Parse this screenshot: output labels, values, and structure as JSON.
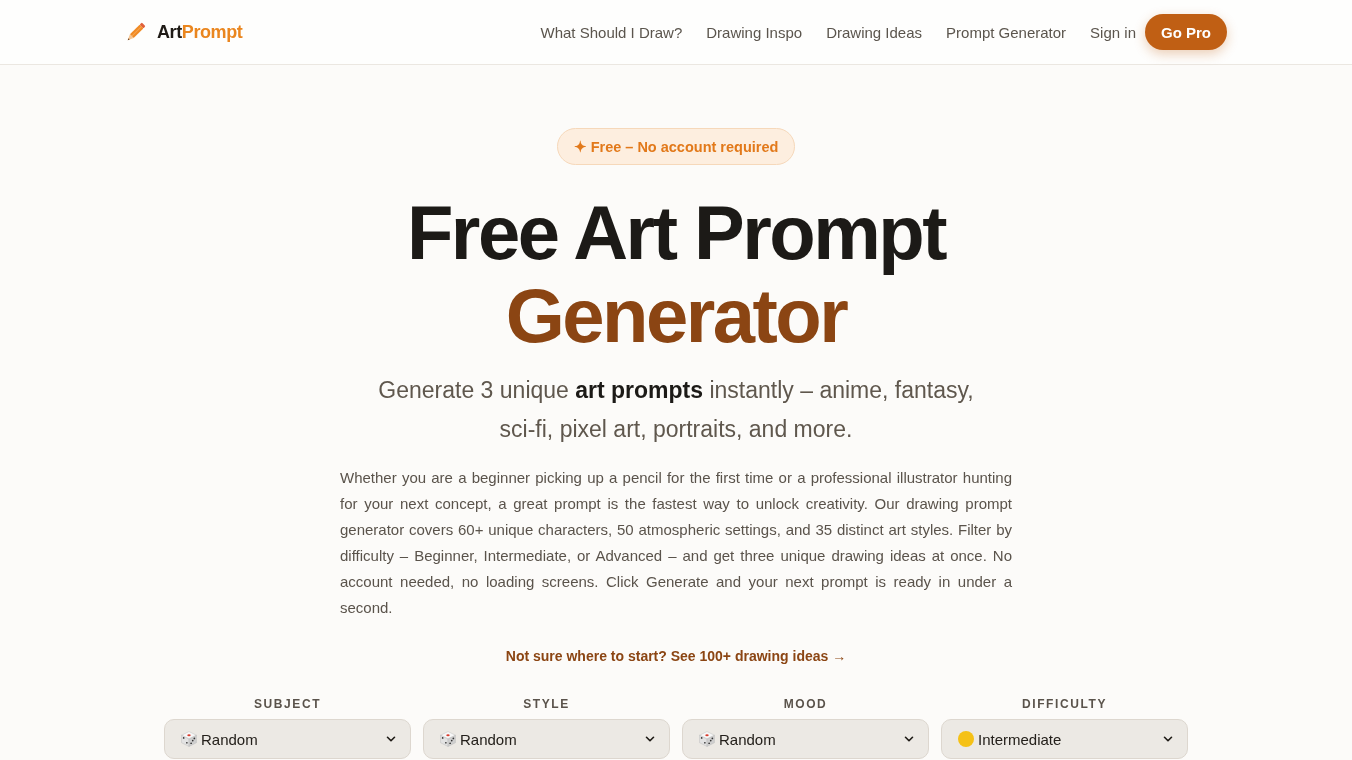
{
  "header": {
    "logo": {
      "name": "Art",
      "name_accent": "Prompt"
    },
    "nav": [
      "What Should I Draw?",
      "Drawing Inspo",
      "Drawing Ideas",
      "Prompt Generator"
    ],
    "sign_in": "Sign in",
    "cta": "Go Pro"
  },
  "hero": {
    "badge": "✦ Free – No account required",
    "title": "Free Art Prompt",
    "title_accent": "Generator",
    "subtitle": "Generate 3 unique **art prompts** instantly – anime, fantasy, sci-fi, pixel art, portraits, and more.",
    "description": "Whether you are a beginner picking up a pencil for the first time or a professional illustrator hunting for your next concept, a great prompt is the fastest way to unlock creativity. Our drawing prompt generator covers 60+ unique characters, 50 atmospheric settings, and 35 distinct art styles. Filter by difficulty – Beginner, Intermediate, or Advanced – and get three unique drawing ideas at once. No account needed, no loading screens. Click Generate and your next prompt is ready in under a second.",
    "link": "Not sure where to start? See 100+ drawing ideas →"
  },
  "filters": [
    {
      "label": "SUBJECT",
      "value": "Random",
      "kind": "random"
    },
    {
      "label": "STYLE",
      "value": "Random",
      "kind": "random"
    },
    {
      "label": "MOOD",
      "value": "Random",
      "kind": "random"
    },
    {
      "label": "DIFFICULTY",
      "value": "Intermediate",
      "kind": "level",
      "color": "#f5c116"
    }
  ]
}
